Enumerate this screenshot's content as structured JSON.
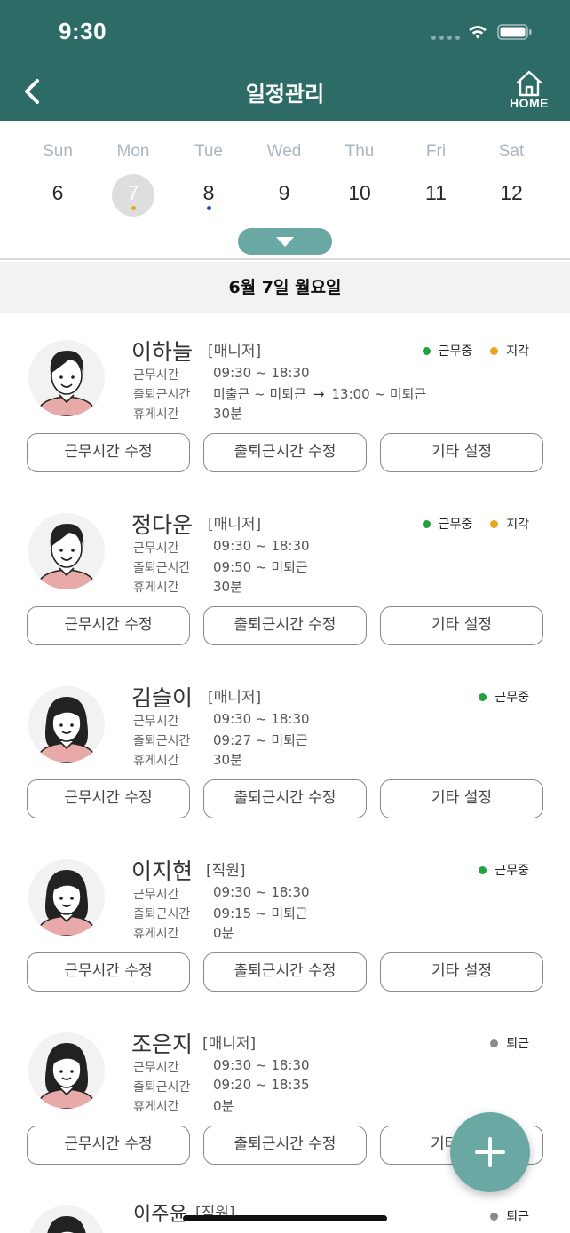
{
  "status_bar": {
    "time": "9:30"
  },
  "header": {
    "title": "일정관리",
    "home_label": "HOME"
  },
  "colors": {
    "header_bg": "#2d6b67",
    "accent": "#6aa9a3",
    "working": "#1fa33a",
    "late": "#e8a71e",
    "off": "#8a8a8a",
    "dot_mon": "#e8a71e",
    "dot_tue": "#2550c8"
  },
  "week": {
    "days": [
      {
        "name": "Sun",
        "num": "6"
      },
      {
        "name": "Mon",
        "num": "7"
      },
      {
        "name": "Tue",
        "num": "8"
      },
      {
        "name": "Wed",
        "num": "9"
      },
      {
        "name": "Thu",
        "num": "10"
      },
      {
        "name": "Fri",
        "num": "11"
      },
      {
        "name": "Sat",
        "num": "12"
      }
    ],
    "selected_index": 1
  },
  "selected_date": "6월 7일 월요일",
  "labels": {
    "work_hours": "근무시간",
    "commute": "출퇴근시간",
    "break": "휴게시간",
    "arrow": "→"
  },
  "buttons": {
    "edit_hours": "근무시간 수정",
    "edit_commute": "출퇴근시간 수정",
    "other": "기타 설정",
    "other_partial": "기타"
  },
  "employees": [
    {
      "name": "이하늘",
      "role": "[매니저]",
      "work": "09:30 ~ 18:30",
      "commute": "미출근 ~ 미퇴근",
      "commute2": "13:00 ~ 미퇴근",
      "break": "30분",
      "status": "근무중",
      "status2": "지각",
      "avatar": "male"
    },
    {
      "name": "정다운",
      "role": "[매니저]",
      "work": "09:30 ~ 18:30",
      "commute": "09:50 ~ 미퇴근",
      "break": "30분",
      "status": "근무중",
      "status2": "지각",
      "avatar": "male"
    },
    {
      "name": "김슬이",
      "role": "[매니저]",
      "work": "09:30 ~ 18:30",
      "commute": "09:27 ~ 미퇴근",
      "break": "30분",
      "status": "근무중",
      "avatar": "female"
    },
    {
      "name": "이지현",
      "role": "[직원]",
      "work": "09:30 ~ 18:30",
      "commute": "09:15 ~ 미퇴근",
      "break": "0분",
      "status": "근무중",
      "avatar": "female"
    },
    {
      "name": "조은지",
      "role": "[매니저]",
      "work": "09:30 ~ 18:30",
      "commute": "09:20 ~ 18:35",
      "break": "0분",
      "status": "퇴근",
      "avatar": "female"
    },
    {
      "name": "이주윤",
      "role": "[직원]",
      "status": "퇴근",
      "avatar": "female"
    }
  ],
  "fab": {
    "icon": "plus-icon"
  }
}
